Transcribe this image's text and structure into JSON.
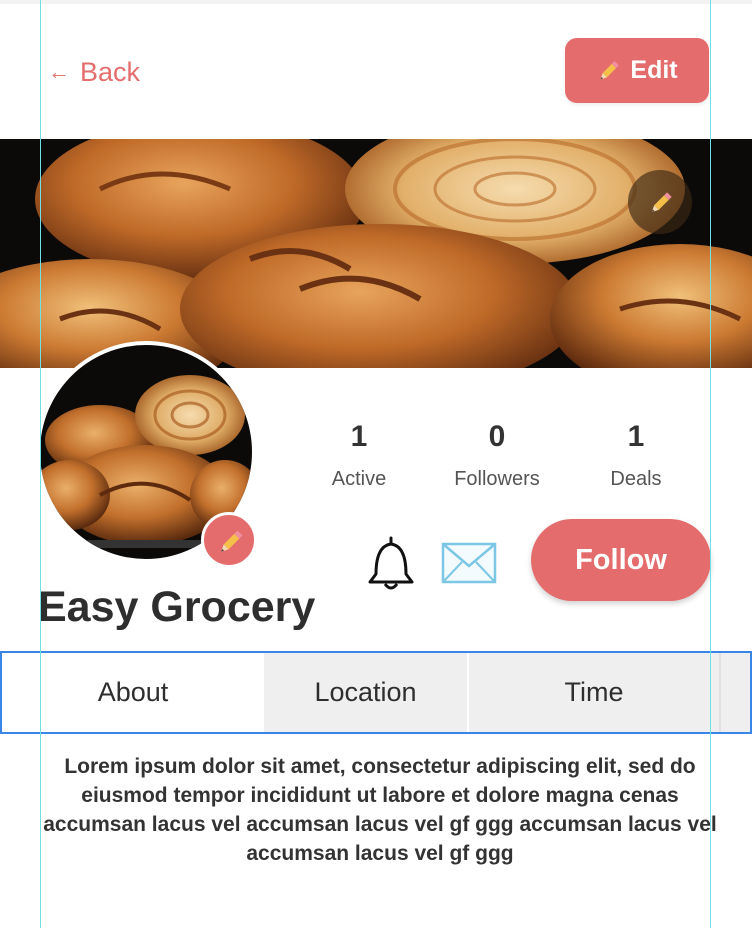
{
  "header": {
    "back_arrow": "←",
    "back_label": "Back",
    "edit_label": "Edit"
  },
  "profile": {
    "name": "Easy Grocery",
    "stats": [
      {
        "value": "1",
        "label": "Active"
      },
      {
        "value": "0",
        "label": "Followers"
      },
      {
        "value": "1",
        "label": "Deals"
      }
    ],
    "follow_label": "Follow"
  },
  "tabs": [
    {
      "label": "About"
    },
    {
      "label": "Location"
    },
    {
      "label": "Time"
    }
  ],
  "about": {
    "text": "Lorem ipsum dolor sit amet, consectetur adipiscing elit, sed do eiusmod tempor incididunt ut labore et dolore magna cenas accumsan lacus vel accumsan lacus vel gf ggg accumsan lacus vel accumsan lacus vel gf ggg"
  },
  "icons": {
    "back": "arrow-left-icon",
    "edit": "pencil-icon",
    "cover_edit": "pencil-icon",
    "avatar_edit": "pencil-icon",
    "notify": "bell-icon",
    "message": "envelope-icon"
  },
  "colors": {
    "accent": "#e56c6c",
    "tab_border": "#3a86e8",
    "tab_inactive_bg": "#efefef"
  }
}
